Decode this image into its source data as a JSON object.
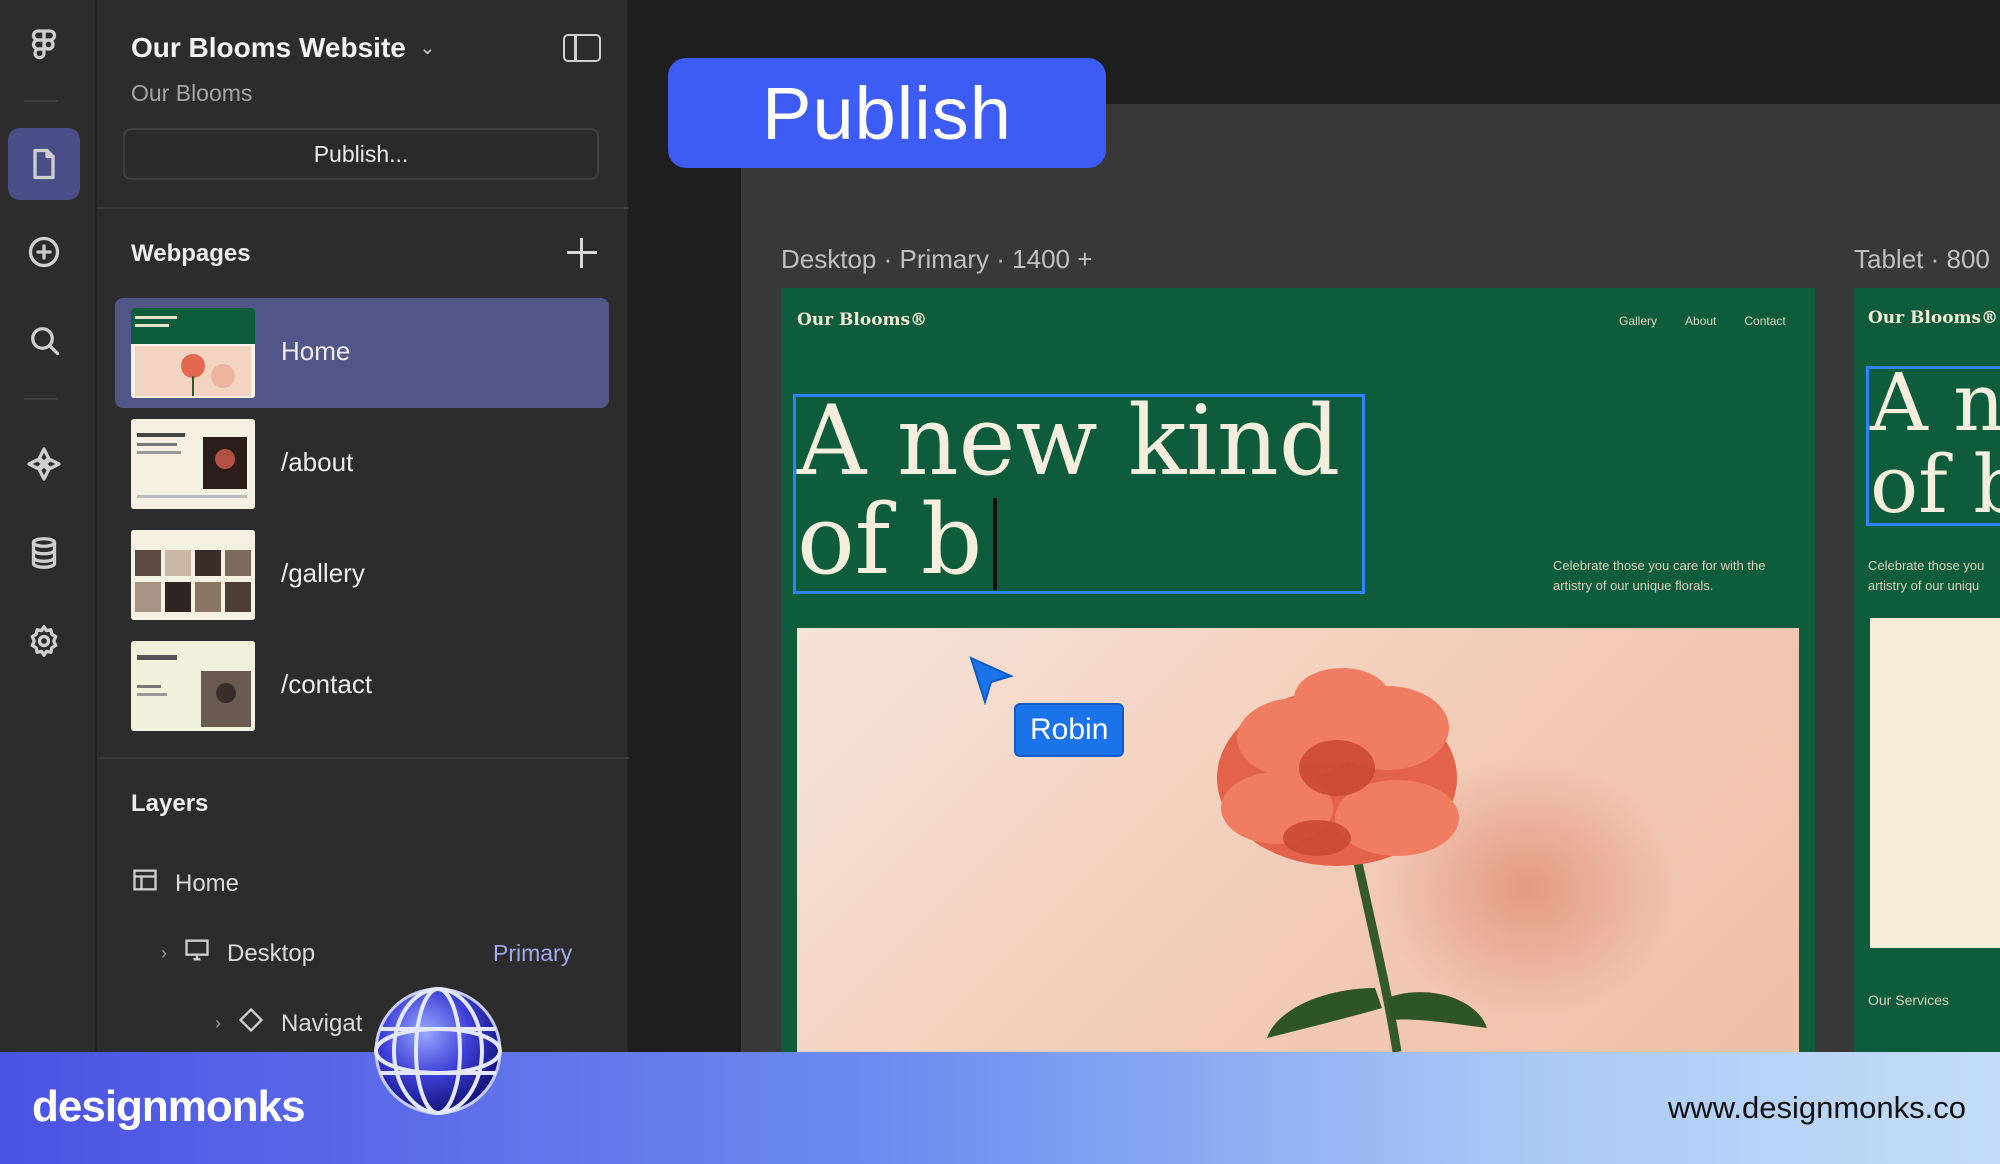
{
  "colors": {
    "accent": "#3c5cf3",
    "selection": "#2d84ff",
    "active_row": "#515587",
    "site_green": "#0f5c3c",
    "collaborator": "#1a73e8"
  },
  "rail": {
    "icons": [
      "figma-logo-icon",
      "pages-icon",
      "add-icon",
      "search-icon",
      "components-icon",
      "database-icon",
      "settings-icon"
    ]
  },
  "panel": {
    "site_title": "Our Blooms Website",
    "site_subtitle": "Our Blooms",
    "publish_button": "Publish...",
    "webpages_label": "Webpages",
    "pages": [
      {
        "label": "Home",
        "active": true
      },
      {
        "label": "/about",
        "active": false
      },
      {
        "label": "/gallery",
        "active": false
      },
      {
        "label": "/contact",
        "active": false
      }
    ],
    "layers_label": "Layers",
    "layers": {
      "home": "Home",
      "desktop": "Desktop",
      "desktop_tag": "Primary",
      "navigation": "Navigat"
    }
  },
  "canvas": {
    "desktop_label": "Desktop · Primary · 1400 +",
    "tablet_label": "Tablet · 800",
    "site": {
      "logo": "Our Blooms®",
      "nav": [
        "Gallery",
        "About",
        "Contact"
      ],
      "hero_line1": "A new kind",
      "hero_line2": "of b",
      "tagline_line1": "Celebrate those you care for with the",
      "tagline_line2": "artistry of our unique florals."
    },
    "tablet_site": {
      "logo": "Our Blooms®",
      "hero_line1": "A n",
      "hero_line2": "of b",
      "tagline_line1": "Celebrate those you",
      "tagline_line2": "artistry of our uniqu",
      "services": "Our Services"
    },
    "collaborator": "Robin"
  },
  "publish_badge": "Publish",
  "footer": {
    "brand": "designmonks",
    "url": "www.designmonks.co"
  }
}
